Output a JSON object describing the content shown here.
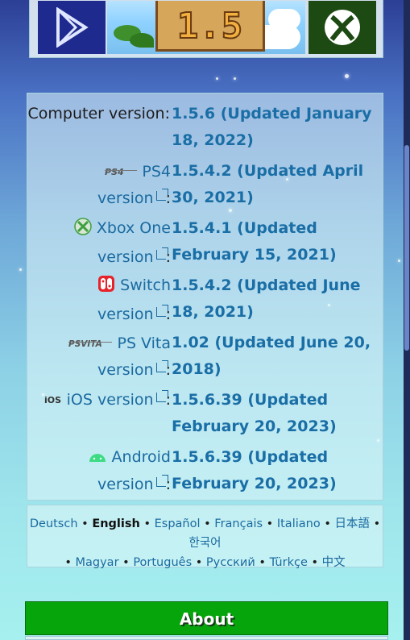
{
  "banner": {
    "art_number": "1.5"
  },
  "versions": [
    {
      "platform": "Computer version",
      "icon": "",
      "value": "1.5.6 (Updated January 18, 2022)"
    },
    {
      "platform": "PS4",
      "suffix": "version",
      "icon": "ps4-logo-icon",
      "value": "1.5.4.2 (Updated April 30, 2021)"
    },
    {
      "platform": "Xbox One",
      "suffix": "version",
      "icon": "xbox-logo-icon",
      "value": "1.5.4.1 (Updated February 15, 2021)"
    },
    {
      "platform": "Switch",
      "suffix": "version",
      "icon": "switch-logo-icon",
      "value": "1.5.4.2 (Updated June 18, 2021)"
    },
    {
      "platform": "PS Vita",
      "suffix": "version",
      "icon": "psvita-logo-icon",
      "value": "1.02 (Updated June 20, 2018)"
    },
    {
      "platform": "iOS version",
      "icon": "ios-logo-icon",
      "value": "1.5.6.39 (Updated February 20, 2023)"
    },
    {
      "platform": "Android",
      "suffix": "version",
      "icon": "android-logo-icon",
      "value": "1.5.6.39 (Updated February 20, 2023)"
    }
  ],
  "languages": [
    "Deutsch",
    "English",
    "Español",
    "Français",
    "Italiano",
    "日本語",
    "한국어",
    "Magyar",
    "Português",
    "Русский",
    "Türkçe",
    "中文"
  ],
  "current_language": "English",
  "separator": "•",
  "about": {
    "label": "About"
  },
  "colors": {
    "link": "#1b6aa0",
    "about_bg": "#06a50b"
  }
}
